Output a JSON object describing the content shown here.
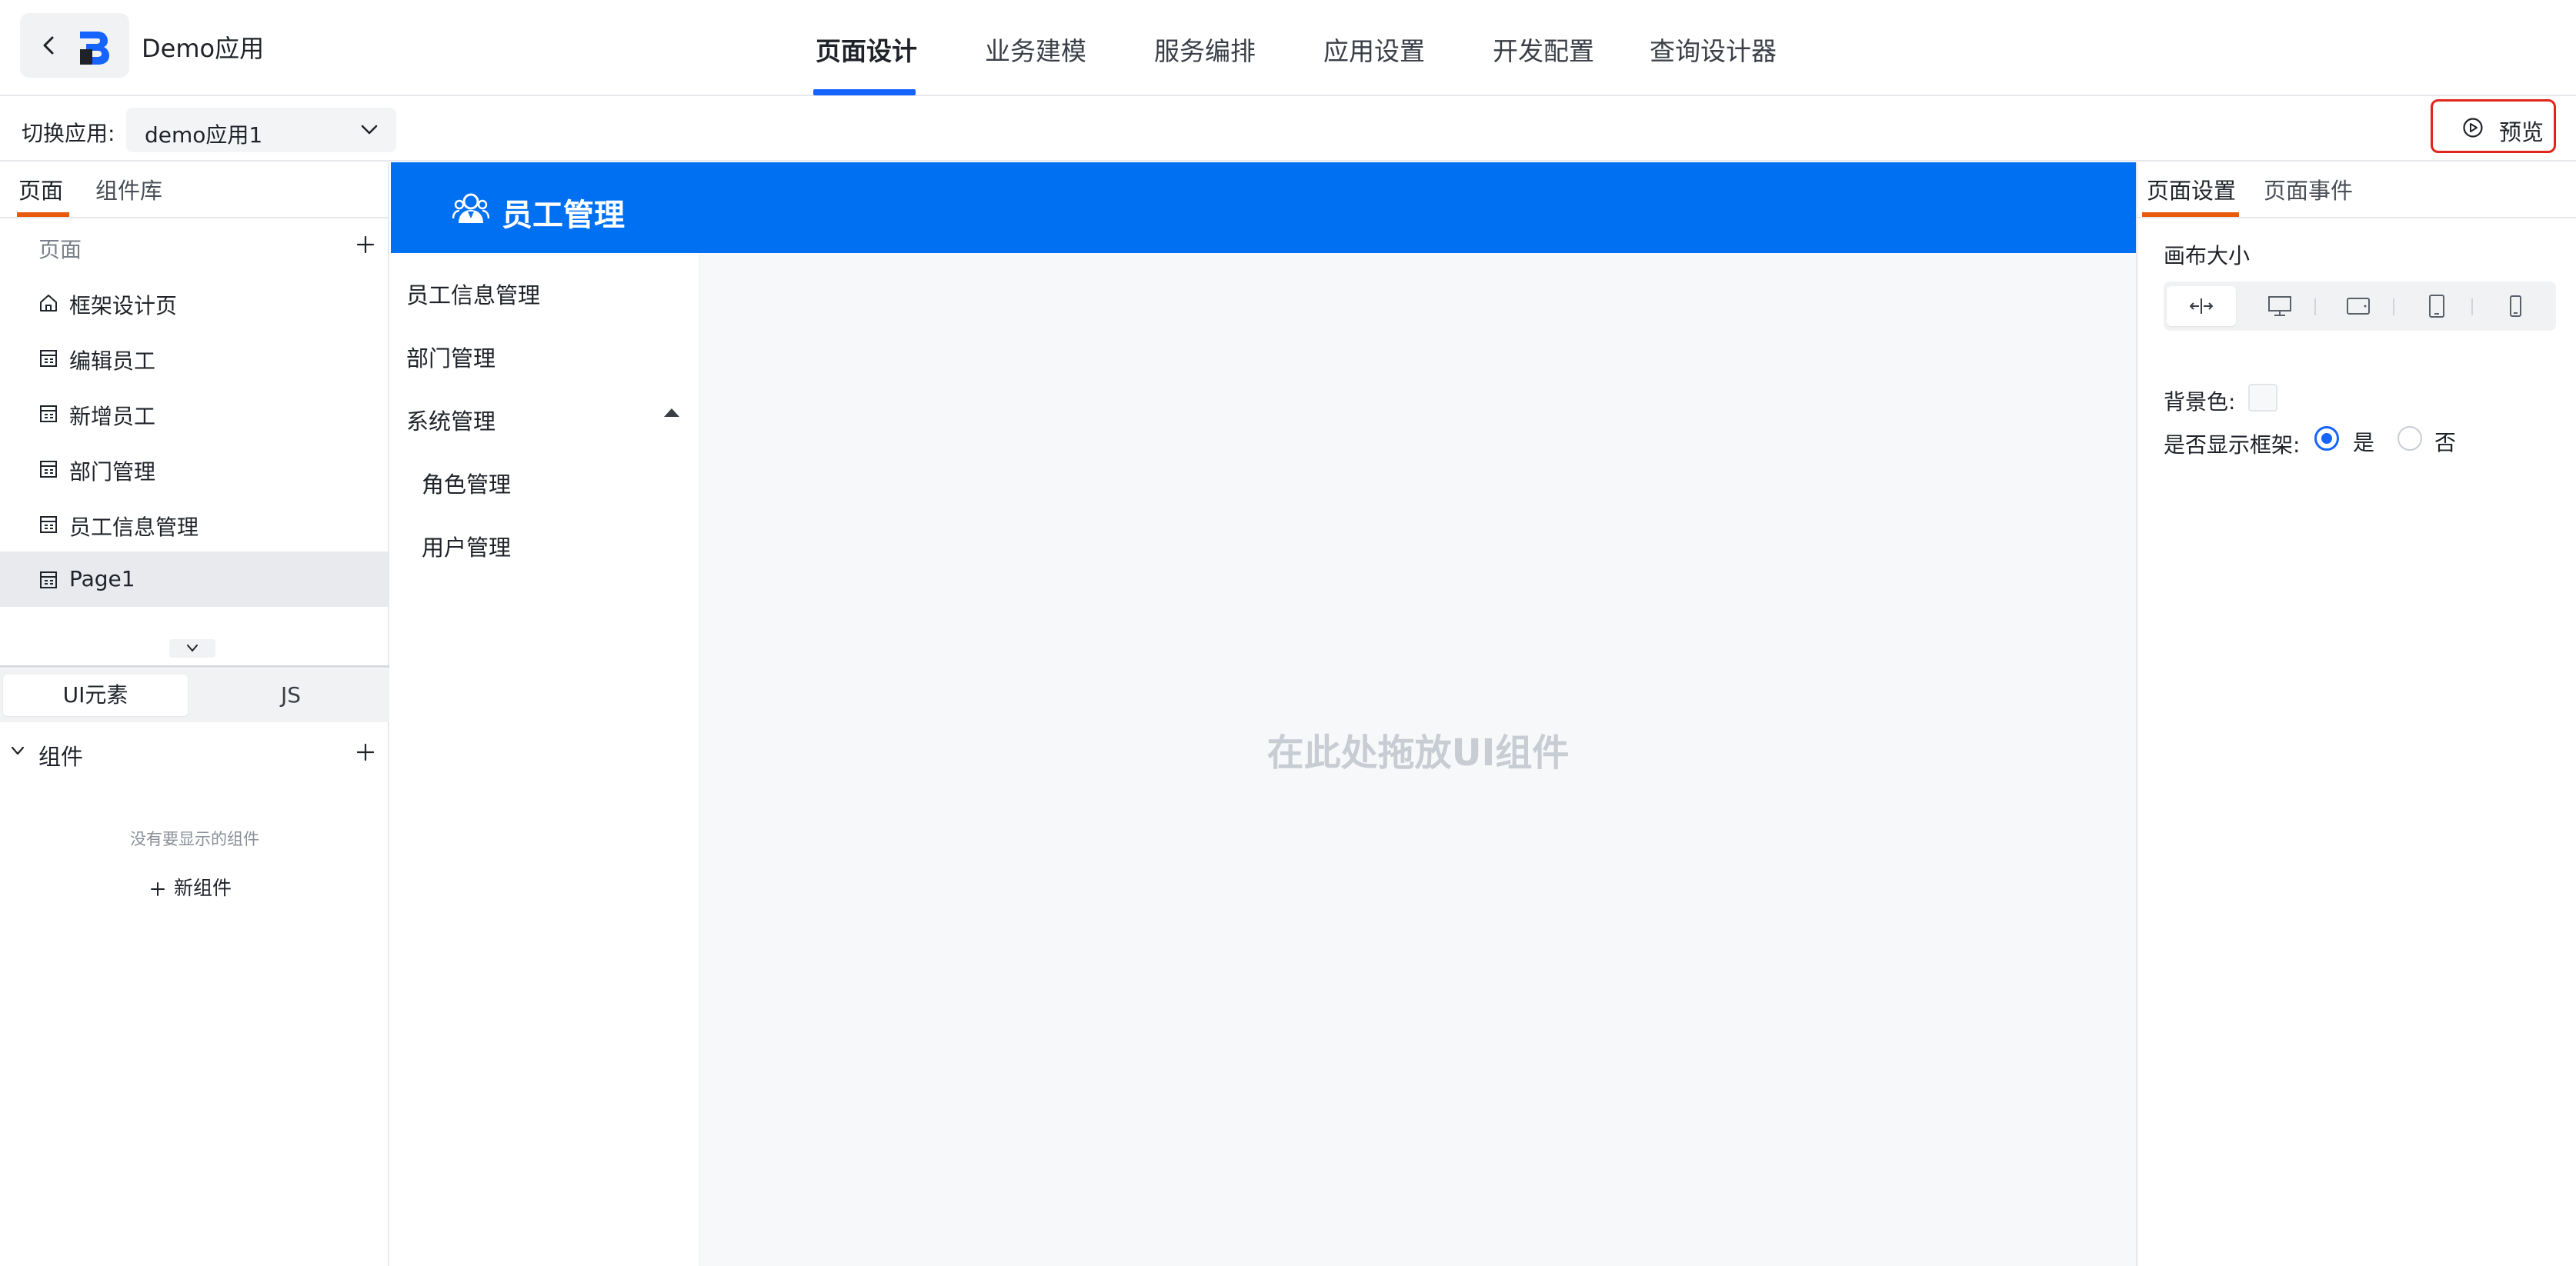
{
  "header": {
    "app_name": "Demo应用",
    "tabs": [
      {
        "label": "页面设计",
        "active": true
      },
      {
        "label": "业务建模"
      },
      {
        "label": "服务编排"
      },
      {
        "label": "应用设置"
      },
      {
        "label": "开发配置"
      },
      {
        "label": "查询设计器"
      }
    ],
    "accent_color": "#1664ff"
  },
  "toolbar": {
    "switch_label": "切换应用:",
    "selected_app": "demo应用1",
    "preview_label": "预览",
    "preview_highlight_color": "#e0261b"
  },
  "left_panel": {
    "tabs": [
      {
        "label": "页面",
        "active": true
      },
      {
        "label": "组件库"
      }
    ],
    "pages_header": "页面",
    "pages": [
      {
        "label": "框架设计页",
        "icon": "home-icon"
      },
      {
        "label": "编辑员工",
        "icon": "page-icon"
      },
      {
        "label": "新增员工",
        "icon": "page-icon"
      },
      {
        "label": "部门管理",
        "icon": "page-icon"
      },
      {
        "label": "员工信息管理",
        "icon": "page-icon"
      },
      {
        "label": "Page1",
        "icon": "page-icon",
        "selected": true
      }
    ],
    "segment": [
      {
        "label": "UI元素",
        "active": true
      },
      {
        "label": "JS"
      }
    ],
    "components_title": "组件",
    "empty_text": "没有要显示的组件",
    "new_component_label": "新组件"
  },
  "canvas": {
    "title": "员工管理",
    "header_color": "#0070f3",
    "menu": [
      {
        "label": "员工信息管理"
      },
      {
        "label": "部门管理"
      },
      {
        "label": "系统管理",
        "expanded": true
      },
      {
        "label": "角色管理",
        "child": true
      },
      {
        "label": "用户管理",
        "child": true
      }
    ],
    "drop_hint": "在此处拖放UI组件"
  },
  "right_panel": {
    "tabs": [
      {
        "label": "页面设置",
        "active": true
      },
      {
        "label": "页面事件"
      }
    ],
    "canvas_size_label": "画布大小",
    "size_options": [
      "auto-width-icon",
      "desktop-icon",
      "tablet-landscape-icon",
      "tablet-portrait-icon",
      "mobile-icon"
    ],
    "bg_color_label": "背景色:",
    "show_frame_label": "是否显示框架:",
    "show_frame_options": [
      {
        "label": "是",
        "checked": true
      },
      {
        "label": "否"
      }
    ]
  }
}
